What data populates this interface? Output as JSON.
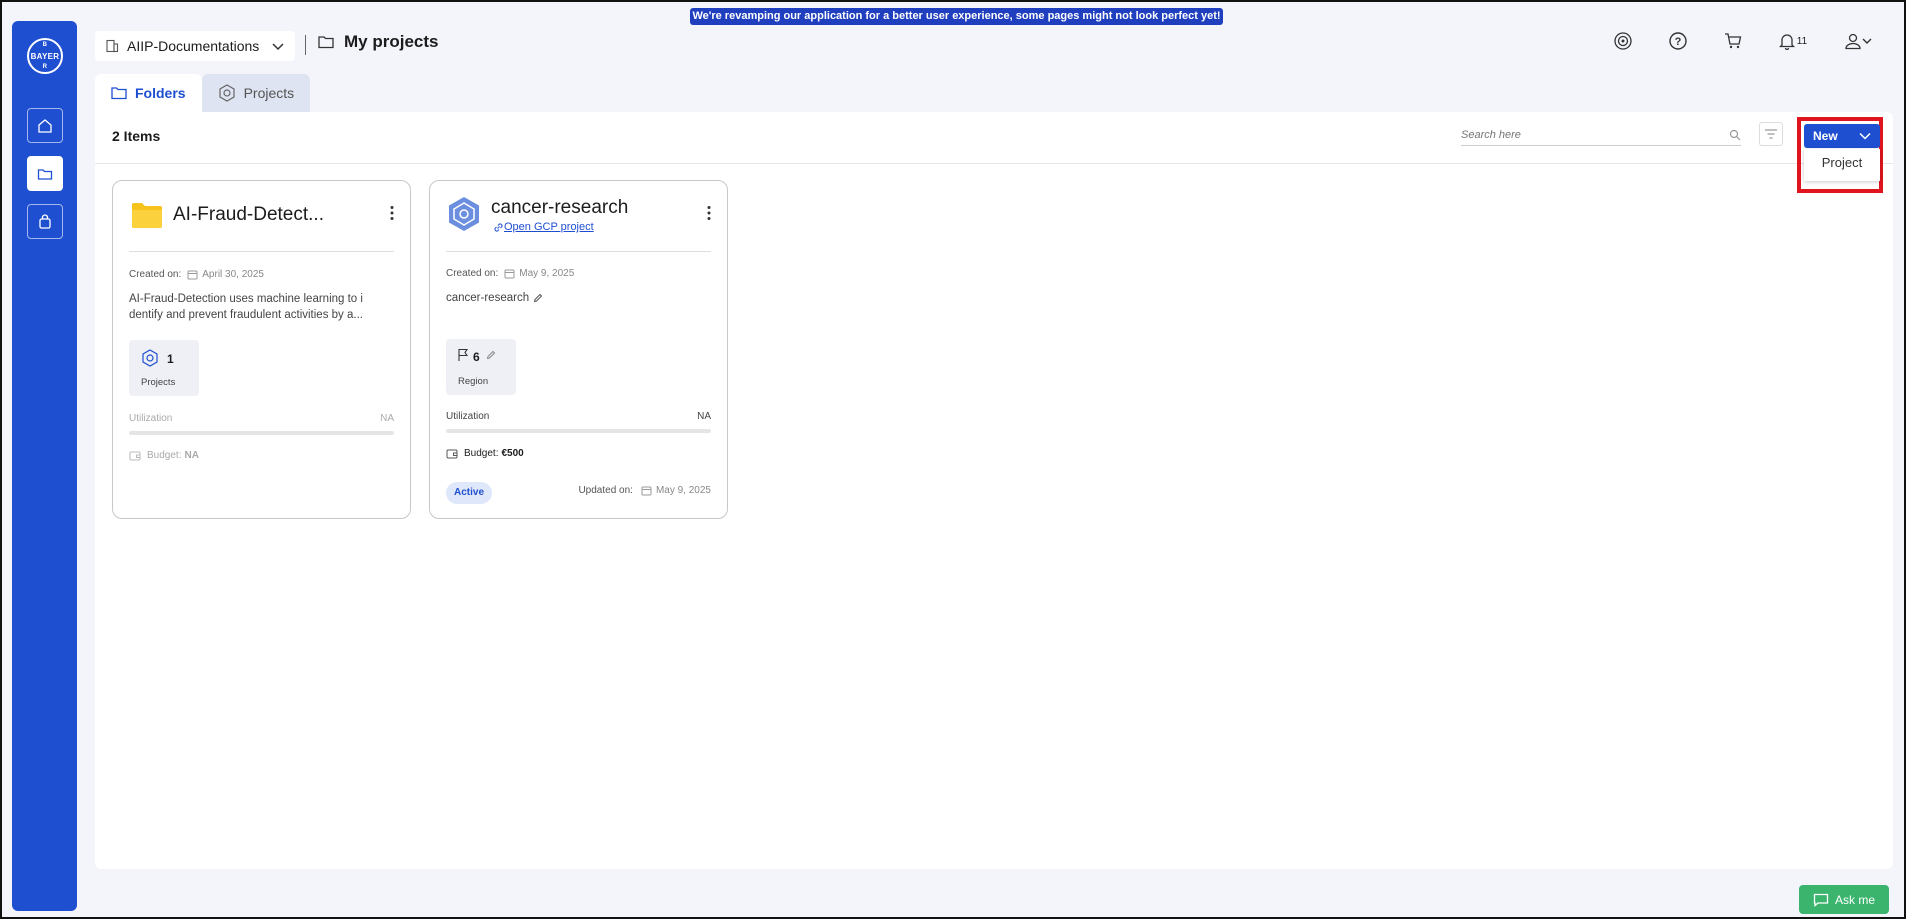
{
  "banner": {
    "text": "We're revamping our application for a better user experience, some pages might not look perfect yet!"
  },
  "sidebar": {
    "logo_text": "BAYER",
    "items": [
      {
        "name": "home-icon"
      },
      {
        "name": "folder-icon"
      },
      {
        "name": "bag-icon"
      }
    ]
  },
  "header": {
    "org_select": "AIIP-Documentations",
    "page_title": "My projects",
    "notifications_count": "11"
  },
  "tabs": [
    {
      "label": "Folders",
      "active": true
    },
    {
      "label": "Projects",
      "active": false
    }
  ],
  "toolbar": {
    "items_count": "2 Items",
    "search_placeholder": "Search here",
    "new_label": "New",
    "new_menu_items": [
      "Project"
    ]
  },
  "cards": [
    {
      "type": "folder",
      "title": "AI-Fraud-Detect...",
      "created_label": "Created on:",
      "created_date": "April 30, 2025",
      "description_line1": "AI-Fraud-Detection uses machine learning to i",
      "description_line2": "dentify and prevent fraudulent activities by a...",
      "stat_value": "1",
      "stat_label": "Projects",
      "utilization_label": "Utilization",
      "utilization_value": "NA",
      "budget_label": "Budget:",
      "budget_value": "NA"
    },
    {
      "type": "project",
      "title": "cancer-research",
      "link_text": "Open GCP project",
      "created_label": "Created on:",
      "created_date": "May 9, 2025",
      "description": "cancer-research",
      "stat_value": "6",
      "stat_label": "Region",
      "utilization_label": "Utilization",
      "utilization_value": "NA",
      "budget_label": "Budget:",
      "budget_value": "€500",
      "status": "Active",
      "updated_label": "Updated on:",
      "updated_date": "May 9, 2025"
    }
  ],
  "ask_me": {
    "label": "Ask me"
  },
  "colors": {
    "accent": "#1f4fd1",
    "highlight": "#e0141e",
    "ask_me": "#3bb46e"
  }
}
